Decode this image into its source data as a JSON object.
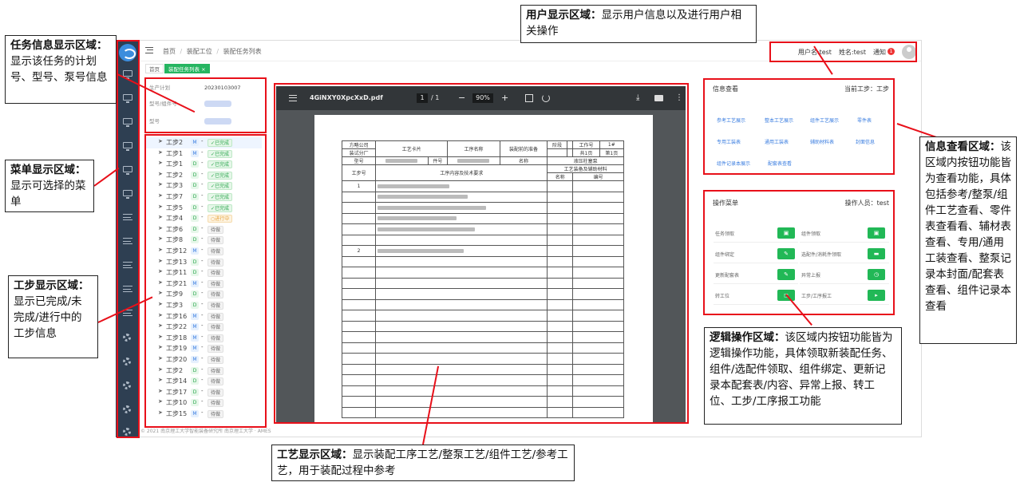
{
  "app": {
    "breadcrumb": [
      "首页",
      "/",
      "装配工位",
      "/",
      "装配任务列表"
    ],
    "user": {
      "username": "用户名:test",
      "name": "姓名:test",
      "notify": "通知",
      "notify_count": "1"
    },
    "tabs": [
      "首页",
      "装配任务列表 ×"
    ],
    "task_info": [
      {
        "label": "生产计划",
        "value": "20230103007"
      },
      {
        "label": "型号/组件号",
        "value": ""
      },
      {
        "label": "型号",
        "value": ""
      }
    ],
    "steps": [
      {
        "name": "工步2",
        "type": "M",
        "status": "已完成"
      },
      {
        "name": "工步1",
        "type": "M",
        "status": "已完成"
      },
      {
        "name": "工步1",
        "type": "D",
        "status": "已完成"
      },
      {
        "name": "工步2",
        "type": "D",
        "status": "已完成"
      },
      {
        "name": "工步3",
        "type": "D",
        "status": "已完成"
      },
      {
        "name": "工步7",
        "type": "D",
        "status": "已完成"
      },
      {
        "name": "工步5",
        "type": "D",
        "status": "已完成"
      },
      {
        "name": "工步4",
        "type": "D",
        "status": "进行中"
      },
      {
        "name": "工步6",
        "type": "D",
        "status": "待做"
      },
      {
        "name": "工步8",
        "type": "D",
        "status": "待做"
      },
      {
        "name": "工步12",
        "type": "M",
        "status": "待做"
      },
      {
        "name": "工步13",
        "type": "D",
        "status": "待做"
      },
      {
        "name": "工步11",
        "type": "D",
        "status": "待做"
      },
      {
        "name": "工步21",
        "type": "M",
        "status": "待做"
      },
      {
        "name": "工步9",
        "type": "D",
        "status": "待做"
      },
      {
        "name": "工步3",
        "type": "D",
        "status": "待做"
      },
      {
        "name": "工步16",
        "type": "M",
        "status": "待做"
      },
      {
        "name": "工步22",
        "type": "M",
        "status": "待做"
      },
      {
        "name": "工步18",
        "type": "M",
        "status": "待做"
      },
      {
        "name": "工步19",
        "type": "M",
        "status": "待做"
      },
      {
        "name": "工步20",
        "type": "M",
        "status": "待做"
      },
      {
        "name": "工步2",
        "type": "D",
        "status": "待做"
      },
      {
        "name": "工步14",
        "type": "D",
        "status": "待做"
      },
      {
        "name": "工步17",
        "type": "D",
        "status": "待做"
      },
      {
        "name": "工步10",
        "type": "D",
        "status": "待做"
      },
      {
        "name": "工步15",
        "type": "M",
        "status": "待做"
      }
    ],
    "pdf": {
      "filename": "4GiNXY0XpcXxD.pdf",
      "page": "1",
      "pages": "/ 1",
      "zoom": "90%",
      "doc": {
        "company": "方略公司",
        "branch": "装试分厂",
        "card_title": "工艺卡片",
        "work_order": "工序名称",
        "work_name": "装配前的准备",
        "stage": "阶段",
        "card_no": "工作号",
        "page_info": "共1页",
        "page_no": "第1页",
        "model": "型号",
        "part": "件号",
        "name": "名称",
        "part_name": "液压柱塞泵",
        "col_step": "工步号",
        "col_content": "工序内容及技术要求",
        "col_tools": "工艺装备及辅助材料",
        "col_tool_name": "名称",
        "col_tool_no": "编号",
        "row1": "1",
        "row2": "2"
      }
    },
    "info_panel": {
      "title": "信息查看",
      "current_step": "当前工步：工步",
      "links": [
        "参考工艺展示",
        "整本工艺展示",
        "组件工艺展示",
        "零件表",
        "专用工装表",
        "通用工装表",
        "辅助材料表",
        "封面信息",
        "组件记录本展示",
        "配套表查看"
      ]
    },
    "op_panel": {
      "title": "操作菜单",
      "operator": "操作人员：test",
      "items": [
        "任务领取",
        "组件领取",
        "组件绑定",
        "选配件/消耗件领取",
        "更新配套表",
        "异常上报",
        "转工位",
        "工步/工序报工"
      ]
    },
    "footer": "© 2021 南京理工大学智能装备研究所 南京理工大学 · AMES"
  },
  "annotations": {
    "user": {
      "title": "用户显示区域：",
      "text": "显示用户信息以及进行用户相关操作"
    },
    "task": {
      "title": "任务信息显示区域：",
      "text": "显示该任务的计划号、型号、泵号信息"
    },
    "menu": {
      "title": "菜单显示区域：",
      "text": "显示可选择的菜单"
    },
    "step": {
      "title": "工步显示区域：",
      "text": "显示已完成/未完成/进行中的工步信息"
    },
    "craft": {
      "title": "工艺显示区域：",
      "text": "显示装配工序工艺/整泵工艺/组件工艺/参考工艺，用于装配过程中参考"
    },
    "info": {
      "title": "信息查看区域：",
      "text": "该区域内按钮功能皆为查看功能，具体包括参考/整泵/组件工艺查看、零件表查看看、辅材表查看、专用/通用工装查看、整泵记录本封面/配套表查看、组件记录本查看"
    },
    "logic": {
      "title": "逻辑操作区域：",
      "text": "该区域内按钮功能皆为逻辑操作功能，具体领取新装配任务、组件/选配件领取、组件绑定、更新记录本配套表/内容、异常上报、转工位、工步/工序报工功能"
    }
  }
}
